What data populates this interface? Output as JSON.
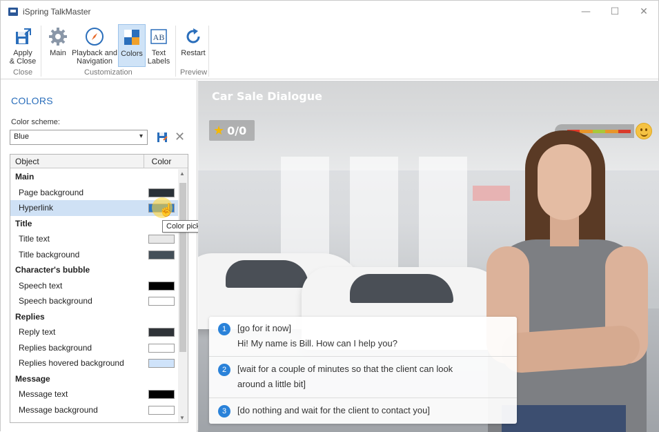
{
  "window": {
    "title": "iSpring TalkMaster",
    "controls": {
      "minimize": "—",
      "maximize": "☐",
      "close": "✕"
    }
  },
  "ribbon": {
    "buttons": [
      {
        "label": "Apply\n& Close",
        "icon": "apply-close-icon"
      },
      {
        "label": "Main",
        "icon": "gear-icon"
      },
      {
        "label": "Playback and\nNavigation",
        "icon": "compass-icon"
      },
      {
        "label": "Colors",
        "icon": "colors-icon",
        "active": true
      },
      {
        "label": "Text\nLabels",
        "icon": "text-labels-icon"
      },
      {
        "label": "Restart",
        "icon": "restart-icon"
      }
    ],
    "groups": [
      "Close",
      "Customization",
      "Preview"
    ]
  },
  "colors_panel": {
    "title": "COLORS",
    "scheme_label": "Color scheme:",
    "scheme_value": "Blue",
    "columns": [
      "Object",
      "Color"
    ],
    "rows": [
      {
        "type": "group",
        "label": "Main"
      },
      {
        "type": "item",
        "label": "Page background",
        "color": "#2a3138"
      },
      {
        "type": "item",
        "label": "Hyperlink",
        "color": "#2b77c8",
        "selected": true
      },
      {
        "type": "group",
        "label": "Title"
      },
      {
        "type": "item",
        "label": "Title text",
        "color": "#e8e8e8"
      },
      {
        "type": "item",
        "label": "Title background",
        "color": "#444f58"
      },
      {
        "type": "group",
        "label": "Character's bubble"
      },
      {
        "type": "item",
        "label": "Speech text",
        "color": "#000000"
      },
      {
        "type": "item",
        "label": "Speech background",
        "color": "#ffffff"
      },
      {
        "type": "group",
        "label": "Replies"
      },
      {
        "type": "item",
        "label": "Reply text",
        "color": "#2f3338"
      },
      {
        "type": "item",
        "label": "Replies background",
        "color": "#ffffff"
      },
      {
        "type": "item",
        "label": "Replies hovered background",
        "color": "#cfe3fa"
      },
      {
        "type": "group",
        "label": "Message"
      },
      {
        "type": "item",
        "label": "Message text",
        "color": "#000000"
      },
      {
        "type": "item",
        "label": "Message background",
        "color": "#ffffff"
      }
    ],
    "tooltip": "Color picker"
  },
  "preview": {
    "title": "Car Sale Dialogue",
    "score": "0/0",
    "meter_colors": [
      "#e23a2a",
      "#e8962a",
      "#a8c83a",
      "#e8962a",
      "#d93a2a"
    ],
    "replies": [
      {
        "num": "1",
        "line1": "[go for it now]",
        "line2": "Hi! My name is Bill. How can I help you?"
      },
      {
        "num": "2",
        "line1": "[wait for a couple of minutes so that the client can look",
        "line2": "around a little bit]"
      },
      {
        "num": "3",
        "line1": "[do nothing and wait for the client to contact you]",
        "line2": ""
      }
    ]
  }
}
